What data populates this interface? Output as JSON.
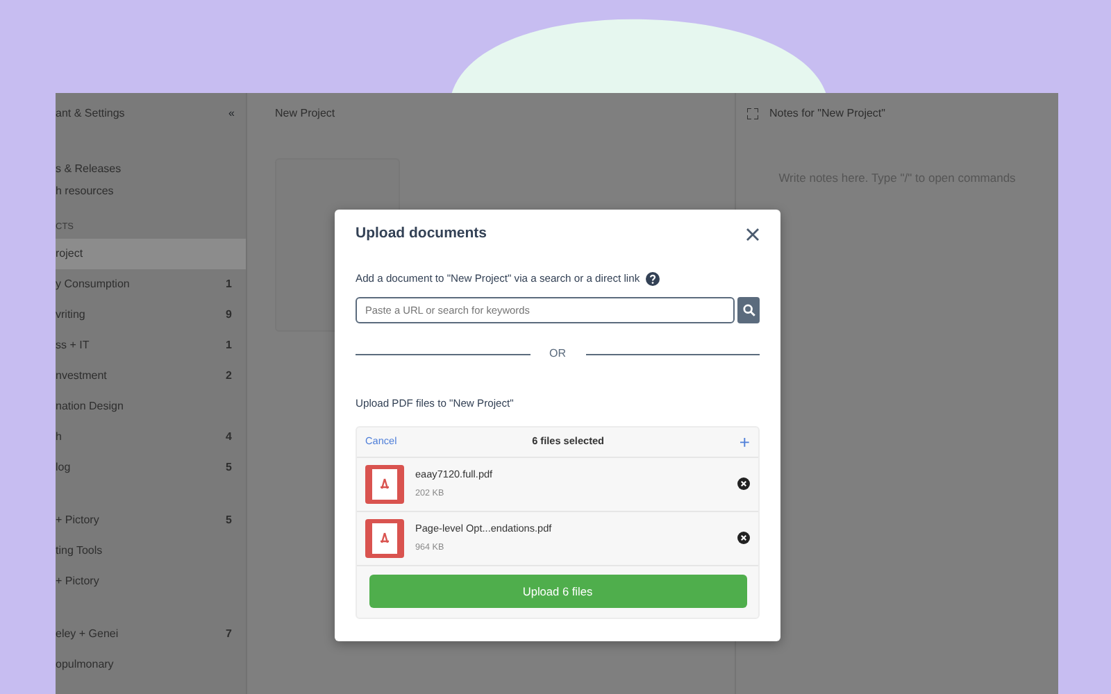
{
  "sidebar": {
    "header": "ant & Settings",
    "collapse_icon": "«",
    "groups": [
      {
        "items": [
          {
            "label": "s & Releases",
            "selected": false
          },
          {
            "label": "h resources",
            "selected": false
          }
        ]
      },
      {
        "heading": "CTS",
        "items": [
          {
            "label": "roject",
            "selected": true
          },
          {
            "label": "y Consumption",
            "count": "1",
            "selected": false
          },
          {
            "label": "vriting",
            "count": "9",
            "selected": false
          },
          {
            "label": "ss + IT",
            "count": "1",
            "selected": false
          },
          {
            "label": "nvestment",
            "count": "2",
            "selected": false
          },
          {
            "label": "nation Design",
            "selected": false
          },
          {
            "label": "h",
            "count": "4",
            "selected": false
          },
          {
            "label": "log",
            "count": "5",
            "selected": false
          }
        ]
      },
      {
        "items": [
          {
            "label": "+ Pictory",
            "count": "5",
            "selected": false
          },
          {
            "label": "ting Tools",
            "selected": false
          },
          {
            "label": "+ Pictory",
            "selected": false
          }
        ]
      },
      {
        "items": [
          {
            "label": "eley + Genei",
            "count": "7",
            "selected": false
          },
          {
            "label": "opulmonary",
            "selected": false
          }
        ]
      }
    ]
  },
  "main": {
    "title": "New Project"
  },
  "notes": {
    "title": "Notes for \"New Project\"",
    "placeholder": "Write notes here. Type \"/\" to open commands"
  },
  "dialog": {
    "title": "Upload documents",
    "link_prompt": "Add a document to \"New Project\" via a search or a direct link",
    "search": {
      "placeholder": "Paste a URL or search for keywords"
    },
    "divider": "OR",
    "upload_prompt": "Upload PDF files to \"New Project\"",
    "files_header": {
      "cancel": "Cancel",
      "count": "6 files selected",
      "add": "+"
    },
    "files": [
      {
        "name": "eaay7120.full.pdf",
        "size": "202 KB"
      },
      {
        "name": "Page-level Opt...endations.pdf",
        "size": "964 KB"
      }
    ],
    "upload_button": "Upload 6 files"
  }
}
